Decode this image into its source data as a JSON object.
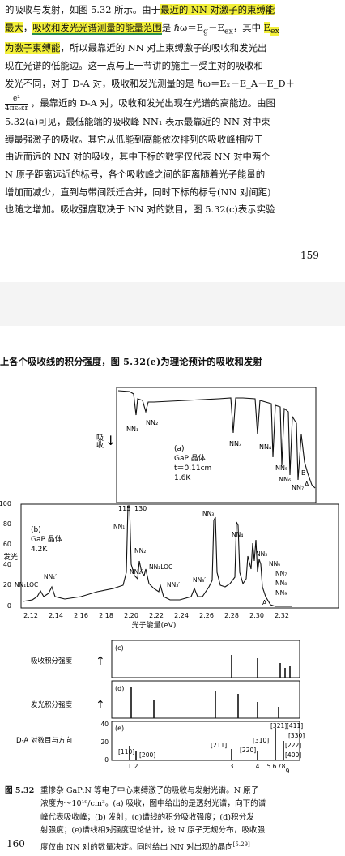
{
  "top_page": {
    "line1_a": "的吸收与发射，如图 5.32 所示。由于",
    "line1_hl": "最近的 NN 对激子的束缚能",
    "line2_hl1": "最大",
    "line2_b": "，",
    "line2_hl2": "吸收和发光光谱测量的能量范围",
    "line2_c": "是 ℏω＝E",
    "line2_d": "g",
    "line2_e": "－E",
    "line2_f": "ex",
    "line2_g": "，其中 ",
    "line2_hl3": "E",
    "line2_h": "ex",
    "line3_hl": "为激子束缚能",
    "line3_b": "，所以最靠近的 NN 对上束缚激子的吸收和发光出",
    "line4": "现在光谱的低能边。这一点与上一节讲的施主－受主对的吸收和",
    "line5": "发光不同，对于 D-A 对，吸收和发光测量的是 ℏω＝Eₓ－E_A－E_D＋",
    "line6_frac_num": "e²",
    "line6_frac_den": "4πε₀εr",
    "line6_b": "，最靠近的 D-A 对，吸收和发光出现在光谱的高能边。由图",
    "line7": "5.32(a)可见，最低能端的吸收峰 NN₁ 表示最靠近的 NN 对中束",
    "line8": "缚最强激子的吸收。其它从低能到高能依次排列的吸收峰相应于",
    "line9": "由近而远的 NN 对的吸收，其中下标的数字仅代表 NN 对中两个",
    "line10": "N 原子距离远近的标号，各个吸收峰之间的距离随着光子能量的",
    "line11": "增加而减少，直到与带间跃迁合并，同时下标的标号(NN 对间距)",
    "line12": "也随之增加。吸收强度取决于 NN 对的数目，图 5.32(c)表示实验",
    "page_number": "159"
  },
  "bottom_page": {
    "header": "上各个吸收线的积分强度，图 5.32(e)为理论预计的吸收和发射",
    "page_number": "160"
  },
  "figure": {
    "panel_a": {
      "axis_label": "吸收",
      "label": "(a)",
      "sample": "GaP 晶体",
      "thickness": "t＝0.11cm",
      "temperature": "1.6K",
      "peaks": [
        "NN₁",
        "NN₂",
        "NN₃",
        "NN₄",
        "NN₅",
        "NN₆",
        "NN₇",
        "B",
        "A"
      ]
    },
    "panel_b": {
      "label": "(b)",
      "sample": "GaP 晶体",
      "temperature": "4.2K",
      "ylabel": "发光",
      "yticks": [
        "100",
        "80",
        "60",
        "40",
        "20",
        "0"
      ],
      "xticks": [
        "2.12",
        "2.14",
        "2.16",
        "2.18",
        "2.20",
        "2.22",
        "2.24",
        "2.26",
        "2.28",
        "2.30",
        "2.32"
      ],
      "xlabel": "光子能量(eV)",
      "scale_a": "115",
      "scale_b": "130",
      "peaks": [
        "NN₁LOC",
        "NN₁′",
        "NN₁",
        "NN₂",
        "NN₂′",
        "NN₂LOC",
        "NN₃′",
        "NN₃",
        "NN₃′",
        "NN₄",
        "NN₅",
        "NN₆",
        "NN₇",
        "NN₈",
        "NN₉",
        "A"
      ]
    },
    "panel_c": {
      "label": "(c)",
      "ylabel": "吸收积分强度"
    },
    "panel_d": {
      "label": "(d)",
      "ylabel": "发光积分强度"
    },
    "panel_e": {
      "label": "(e)",
      "ylabel": "D-A 对数目与方向",
      "yticks": [
        "40",
        "20",
        "0"
      ],
      "xticks": [
        "1",
        "2",
        "3",
        "4",
        "5",
        "6",
        "7",
        "8",
        "9"
      ],
      "directions": [
        "[110]",
        "[200]",
        "[211]",
        "[220]",
        "[310]",
        "[321]",
        "[411]",
        "[330]",
        "[222]",
        "[400]"
      ]
    }
  },
  "caption": {
    "label": "图 5.32",
    "line1": "重掺杂 GaP:N 等电子中心束缚激子的吸收与发射光谱。N 原子",
    "line2": "浓度为～10¹⁹/cm³。(a) 吸收，图中给出的是透射光谱，向下的谱",
    "line3": "峰代表吸收峰；(b) 发射；(c)谱线的积分吸收强度；(d)积分发",
    "line4": "射强度；(e)谱线相对强度理论估计，设 N 原子无规分布，吸收强",
    "line5": "度仅由 NN 对的数量决定。同时给出 NN 对出现的晶向",
    "ref": "[5.29]"
  }
}
